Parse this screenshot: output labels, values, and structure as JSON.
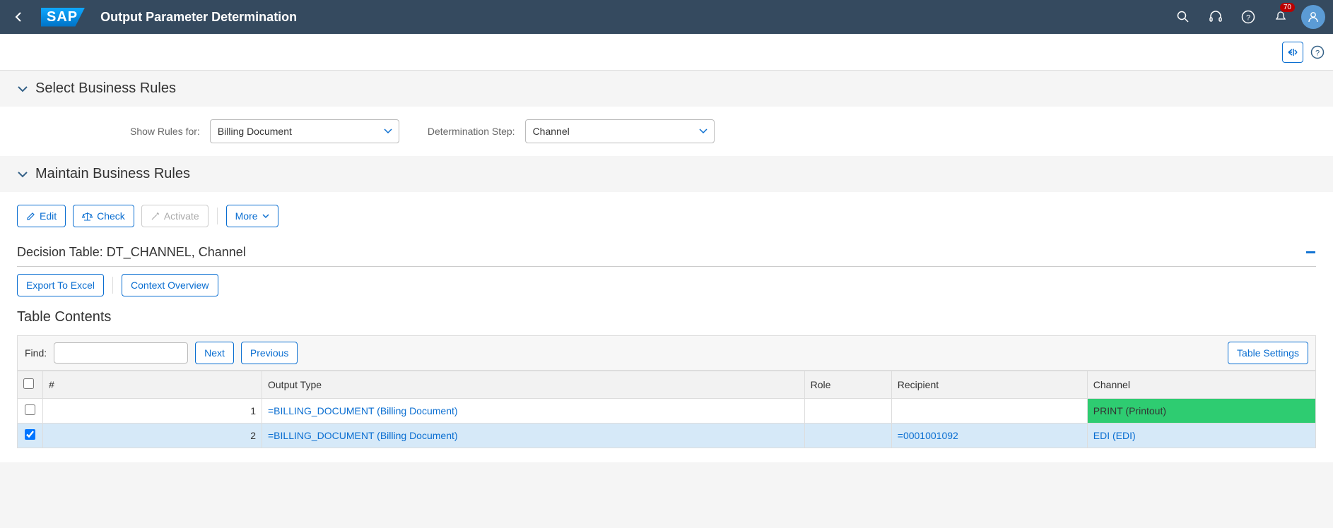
{
  "header": {
    "title": "Output Parameter Determination",
    "logo_text": "SAP",
    "notification_count": "70"
  },
  "sections": {
    "select_rules": "Select Business Rules",
    "maintain_rules": "Maintain Business Rules"
  },
  "form": {
    "show_rules_label": "Show Rules for:",
    "show_rules_value": "Billing Document",
    "step_label": "Determination Step:",
    "step_value": "Channel"
  },
  "buttons": {
    "edit": "Edit",
    "check": "Check",
    "activate": "Activate",
    "more": "More",
    "export": "Export To Excel",
    "context": "Context Overview",
    "next": "Next",
    "previous": "Previous",
    "table_settings": "Table Settings"
  },
  "decision_title": "Decision Table: DT_CHANNEL, Channel",
  "table_caption": "Table Contents",
  "find_label": "Find:",
  "columns": {
    "num": "#",
    "output_type": "Output Type",
    "role": "Role",
    "recipient": "Recipient",
    "channel": "Channel"
  },
  "rows": [
    {
      "checked": false,
      "num": "1",
      "output_type": "=BILLING_DOCUMENT (Billing Document)",
      "role": "",
      "recipient": "",
      "channel": "PRINT (Printout)",
      "channel_highlight": true,
      "selected": false
    },
    {
      "checked": true,
      "num": "2",
      "output_type": "=BILLING_DOCUMENT (Billing Document)",
      "role": "",
      "recipient": "=0001001092",
      "channel": "EDI (EDI)",
      "channel_highlight": false,
      "selected": true
    }
  ]
}
